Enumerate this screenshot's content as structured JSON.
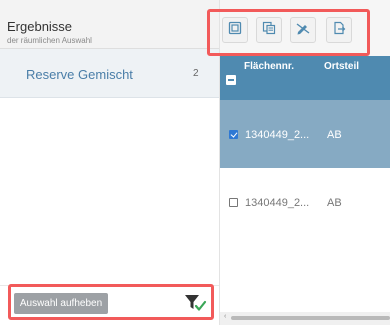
{
  "results_panel": {
    "title": "Ergebnisse",
    "subtitle": "der räumlichen Auswahl",
    "selection": {
      "label": "Reserve Gemischt",
      "count": "2"
    },
    "footer": {
      "clear_button_label": "Auswahl aufheben",
      "filter_icon": "filter-check-icon"
    }
  },
  "toolbar": {
    "buttons": [
      {
        "icon": "select-all-icon"
      },
      {
        "icon": "copy-icon"
      },
      {
        "icon": "edit-off-icon"
      },
      {
        "icon": "export-icon"
      }
    ]
  },
  "table": {
    "columns": [
      "Flächennr.",
      "Ortsteil"
    ],
    "rows": [
      {
        "checked": true,
        "flaechennr": "1340449_2...",
        "ortsteil": "AB"
      },
      {
        "checked": false,
        "flaechennr": "1340449_2...",
        "ortsteil": "AB"
      }
    ]
  },
  "colors": {
    "header_blue": "#4f8ab0",
    "selected_row": "#86aac3",
    "accent_link": "#4a7ea8",
    "highlight_red": "#f25a5a"
  }
}
